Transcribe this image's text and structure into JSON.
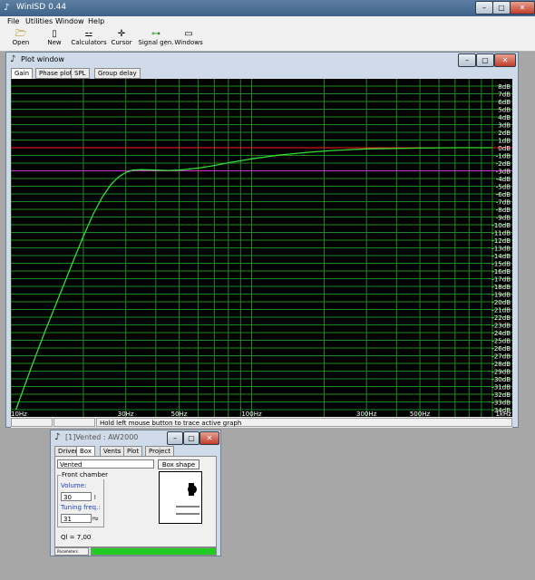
{
  "app": {
    "title": "WinISD 0.44"
  },
  "menu": [
    "File",
    "Utilities",
    "Window",
    "Help"
  ],
  "toolbar": [
    {
      "label": "Open",
      "icon": "folder-open-icon",
      "glyph": "🗁"
    },
    {
      "label": "New",
      "icon": "new-document-icon",
      "glyph": "▯"
    },
    {
      "label": "Calculators",
      "icon": "calculator-icon",
      "glyph": "⚍"
    },
    {
      "label": "Cursor",
      "icon": "crosshair-icon",
      "glyph": "✛"
    },
    {
      "label": "Signal gen.",
      "icon": "signal-generator-icon",
      "glyph": "⊶"
    },
    {
      "label": "Windows",
      "icon": "windows-icon",
      "glyph": "▭"
    }
  ],
  "plot_window": {
    "title": "Plot window",
    "tabs": [
      "Gain",
      "Phase plot",
      "SPL",
      "Group delay"
    ],
    "active_tab": "Gain",
    "status_text": "Hold left mouse button to trace active graph"
  },
  "chart_data": {
    "type": "line",
    "x_scale": "log",
    "xlim": [
      10,
      1000
    ],
    "ylim": [
      -34,
      8
    ],
    "x_tick_labels": [
      {
        "value": 10,
        "label": "10Hz"
      },
      {
        "value": 30,
        "label": "30Hz"
      },
      {
        "value": 50,
        "label": "50Hz"
      },
      {
        "value": 100,
        "label": "100Hz"
      },
      {
        "value": 300,
        "label": "300Hz"
      },
      {
        "value": 500,
        "label": "500Hz"
      },
      {
        "value": 1000,
        "label": "1kHz"
      }
    ],
    "y_tick_labels": [
      "8dB",
      "7dB",
      "6dB",
      "5dB",
      "4dB",
      "3dB",
      "2dB",
      "1dB",
      "0dB",
      "-1dB",
      "-2dB",
      "-3dB",
      "-4dB",
      "-5dB",
      "-6dB",
      "-7dB",
      "-8dB",
      "-9dB",
      "-10dB",
      "-11dB",
      "-12dB",
      "-13dB",
      "-14dB",
      "-15dB",
      "-16dB",
      "-17dB",
      "-18dB",
      "-19dB",
      "-20dB",
      "-21dB",
      "-22dB",
      "-23dB",
      "-24dB",
      "-25dB",
      "-26dB",
      "-27dB",
      "-28dB",
      "-29dB",
      "-30dB",
      "-31dB",
      "-32dB",
      "-33dB",
      "-34dB"
    ],
    "grid": true,
    "reference_lines": [
      {
        "y": 0,
        "color": "#ff1a1a"
      },
      {
        "y": -3,
        "color": "#cc33cc"
      }
    ],
    "series": [
      {
        "color": "#33dd33",
        "x": [
          10.5,
          12,
          14,
          16,
          18,
          20,
          22,
          24,
          26,
          28,
          30,
          32,
          35,
          40,
          45,
          50,
          60,
          70,
          80,
          100,
          130,
          170,
          220,
          300,
          500,
          700,
          1000
        ],
        "y": [
          -34,
          -29,
          -23.5,
          -19,
          -15,
          -11.5,
          -8.6,
          -6.4,
          -4.8,
          -3.8,
          -3.2,
          -2.9,
          -2.85,
          -2.9,
          -2.95,
          -2.9,
          -2.65,
          -2.3,
          -1.95,
          -1.45,
          -0.95,
          -0.6,
          -0.35,
          -0.15,
          -0.05,
          0,
          0
        ]
      }
    ]
  },
  "vented_window": {
    "title": "[1]Vented : AW2000",
    "tabs": [
      "Driver",
      "Box",
      "Vents",
      "Plot",
      "Project"
    ],
    "active_tab": "Box",
    "box_type_value": "Vented",
    "box_shape_button": "Box shape",
    "front_chamber_label": "Front chamber",
    "volume_label": "Volume:",
    "volume_value": "30",
    "volume_unit": "l",
    "tuning_label": "Tuning freq.:",
    "tuning_value": "31",
    "tuning_unit": "Hz",
    "ql_text": "Ql = 7,00",
    "status_label": "Parameters"
  },
  "colors": {
    "titlebar": "#4a6e94",
    "plot_background": "#000000",
    "grid": "#1f8a1f",
    "curve": "#33dd33",
    "progress": "#22cc22"
  }
}
